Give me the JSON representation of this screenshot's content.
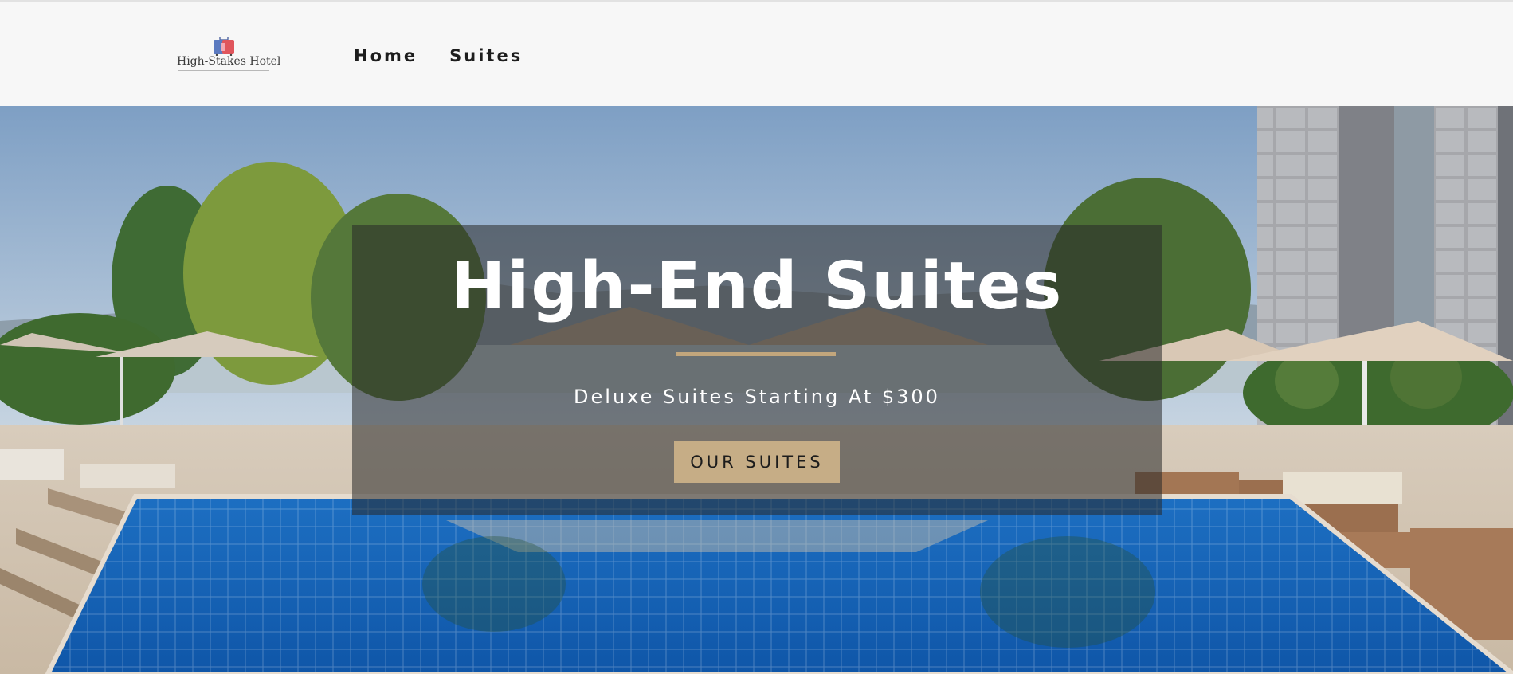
{
  "header": {
    "logo_text": "High-Stakes Hotel",
    "nav": [
      {
        "label": "Home"
      },
      {
        "label": "Suites"
      }
    ]
  },
  "hero": {
    "title": "High-End Suites",
    "subtitle": "Deluxe Suites Starting At $300",
    "cta_label": "OUR SUITES",
    "accent_color": "#c2a67c",
    "button_color": "#c6ad86"
  },
  "icons": {
    "logo": "suitcase-logo-icon"
  }
}
